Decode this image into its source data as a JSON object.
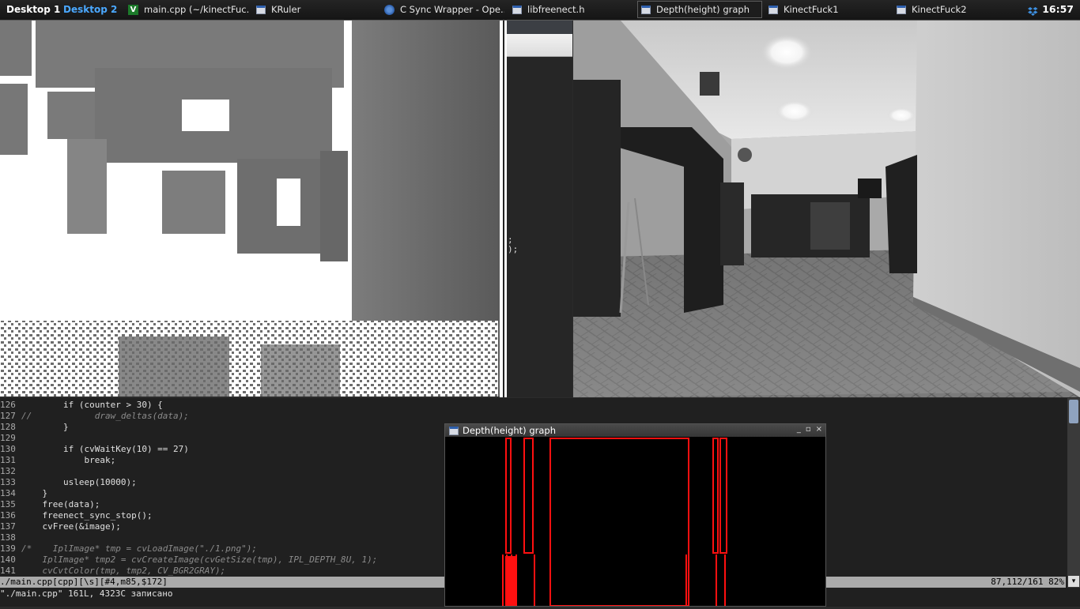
{
  "taskbar": {
    "desktop1": "Desktop 1",
    "desktop2": "Desktop 2",
    "tasks": [
      {
        "label": "main.cpp (~/kinectFuc...",
        "icon": "vim-icon"
      },
      {
        "label": "KRuler",
        "icon": "window-icon"
      },
      {
        "label": "C Sync Wrapper - Ope...",
        "icon": "browser-icon"
      },
      {
        "label": "libfreenect.h",
        "icon": "window-icon"
      },
      {
        "label": "Depth(height) graph",
        "icon": "window-icon"
      },
      {
        "label": "KinectFuck1",
        "icon": "window-icon"
      },
      {
        "label": "KinectFuck2",
        "icon": "window-icon"
      }
    ],
    "clock": "16:57",
    "tray_icon": "dropbox-icon"
  },
  "middle_fragment": {
    "line1": ";",
    "line2": ");"
  },
  "editor": {
    "lines": [
      {
        "n": "126",
        "t": "        if (counter > 30) {"
      },
      {
        "n": "127",
        "t": "//            draw_deltas(data);"
      },
      {
        "n": "128",
        "t": "        }"
      },
      {
        "n": "129",
        "t": ""
      },
      {
        "n": "130",
        "t": "        if (cvWaitKey(10) == 27)"
      },
      {
        "n": "131",
        "t": "            break;"
      },
      {
        "n": "132",
        "t": ""
      },
      {
        "n": "133",
        "t": "        usleep(10000);"
      },
      {
        "n": "134",
        "t": "    }"
      },
      {
        "n": "135",
        "t": "    free(data);"
      },
      {
        "n": "136",
        "t": "    freenect_sync_stop();"
      },
      {
        "n": "137",
        "t": "    cvFree(&image);"
      },
      {
        "n": "138",
        "t": ""
      },
      {
        "n": "139",
        "t": "/*    IplImage* tmp = cvLoadImage(\"./1.png\");"
      },
      {
        "n": "140",
        "t": "    IplImage* tmp2 = cvCreateImage(cvGetSize(tmp), IPL_DEPTH_8U, 1);"
      },
      {
        "n": "141",
        "t": "    cvCvtColor(tmp, tmp2, CV_BGR2GRAY);"
      }
    ],
    "status_left": "./main.cpp[cpp][\\s][#4,m85,$172]",
    "status_right": "87,112/161 82%",
    "message": "\"./main.cpp\" 161L, 4323C записано"
  },
  "graph_window": {
    "title": "Depth(height) graph",
    "minimize": "_",
    "maximize": "▫",
    "close": "×",
    "bar_color": "#ff1010"
  }
}
